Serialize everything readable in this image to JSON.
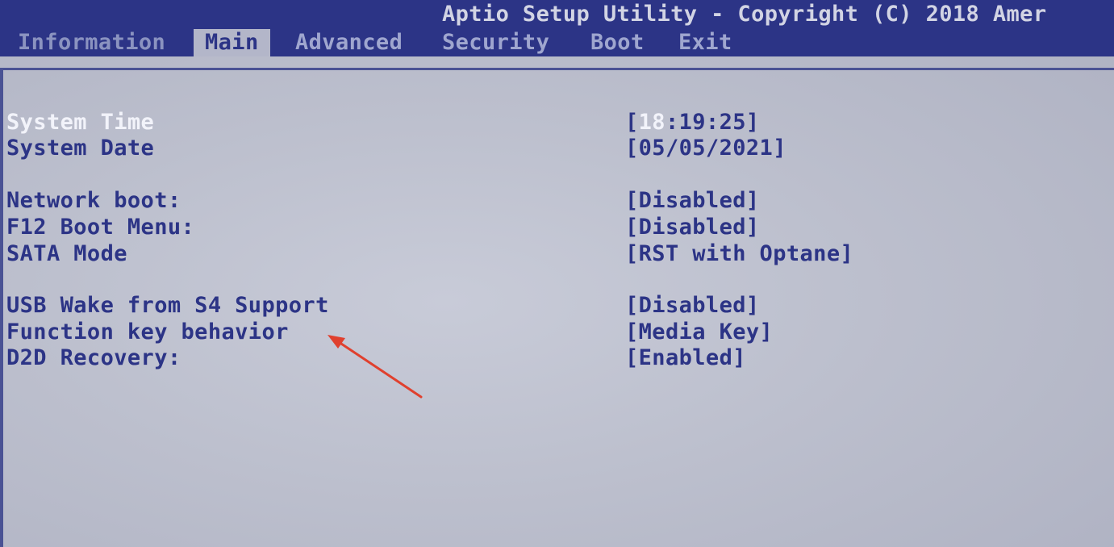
{
  "header": {
    "title": "Aptio Setup Utility - Copyright (C) 2018 Amer"
  },
  "tabs": [
    {
      "label": "Information"
    },
    {
      "label": "Main"
    },
    {
      "label": "Advanced"
    },
    {
      "label": "Security"
    },
    {
      "label": "Boot"
    },
    {
      "label": "Exit"
    }
  ],
  "settings": {
    "system_time": {
      "label": "System Time",
      "open": "[",
      "hour": "18",
      "rest": ":19:25]"
    },
    "system_date": {
      "label": "System Date",
      "value": "[05/05/2021]"
    },
    "network_boot": {
      "label": "Network boot:",
      "value": "[Disabled]"
    },
    "f12_boot_menu": {
      "label": "F12 Boot Menu:",
      "value": "[Disabled]"
    },
    "sata_mode": {
      "label": "SATA Mode",
      "value": "[RST with Optane]"
    },
    "usb_wake": {
      "label": "USB Wake from S4 Support",
      "value": "[Disabled]"
    },
    "function_key": {
      "label": "Function key behavior",
      "value": "[Media Key]"
    },
    "d2d_recovery": {
      "label": "D2D Recovery:",
      "value": "[Enabled]"
    }
  },
  "colors": {
    "bar": "#2c3486",
    "panel": "#bcbfcd",
    "text": "#2c3486",
    "highlight": "#f2f3fa",
    "annotation_arrow": "#e0402e"
  }
}
